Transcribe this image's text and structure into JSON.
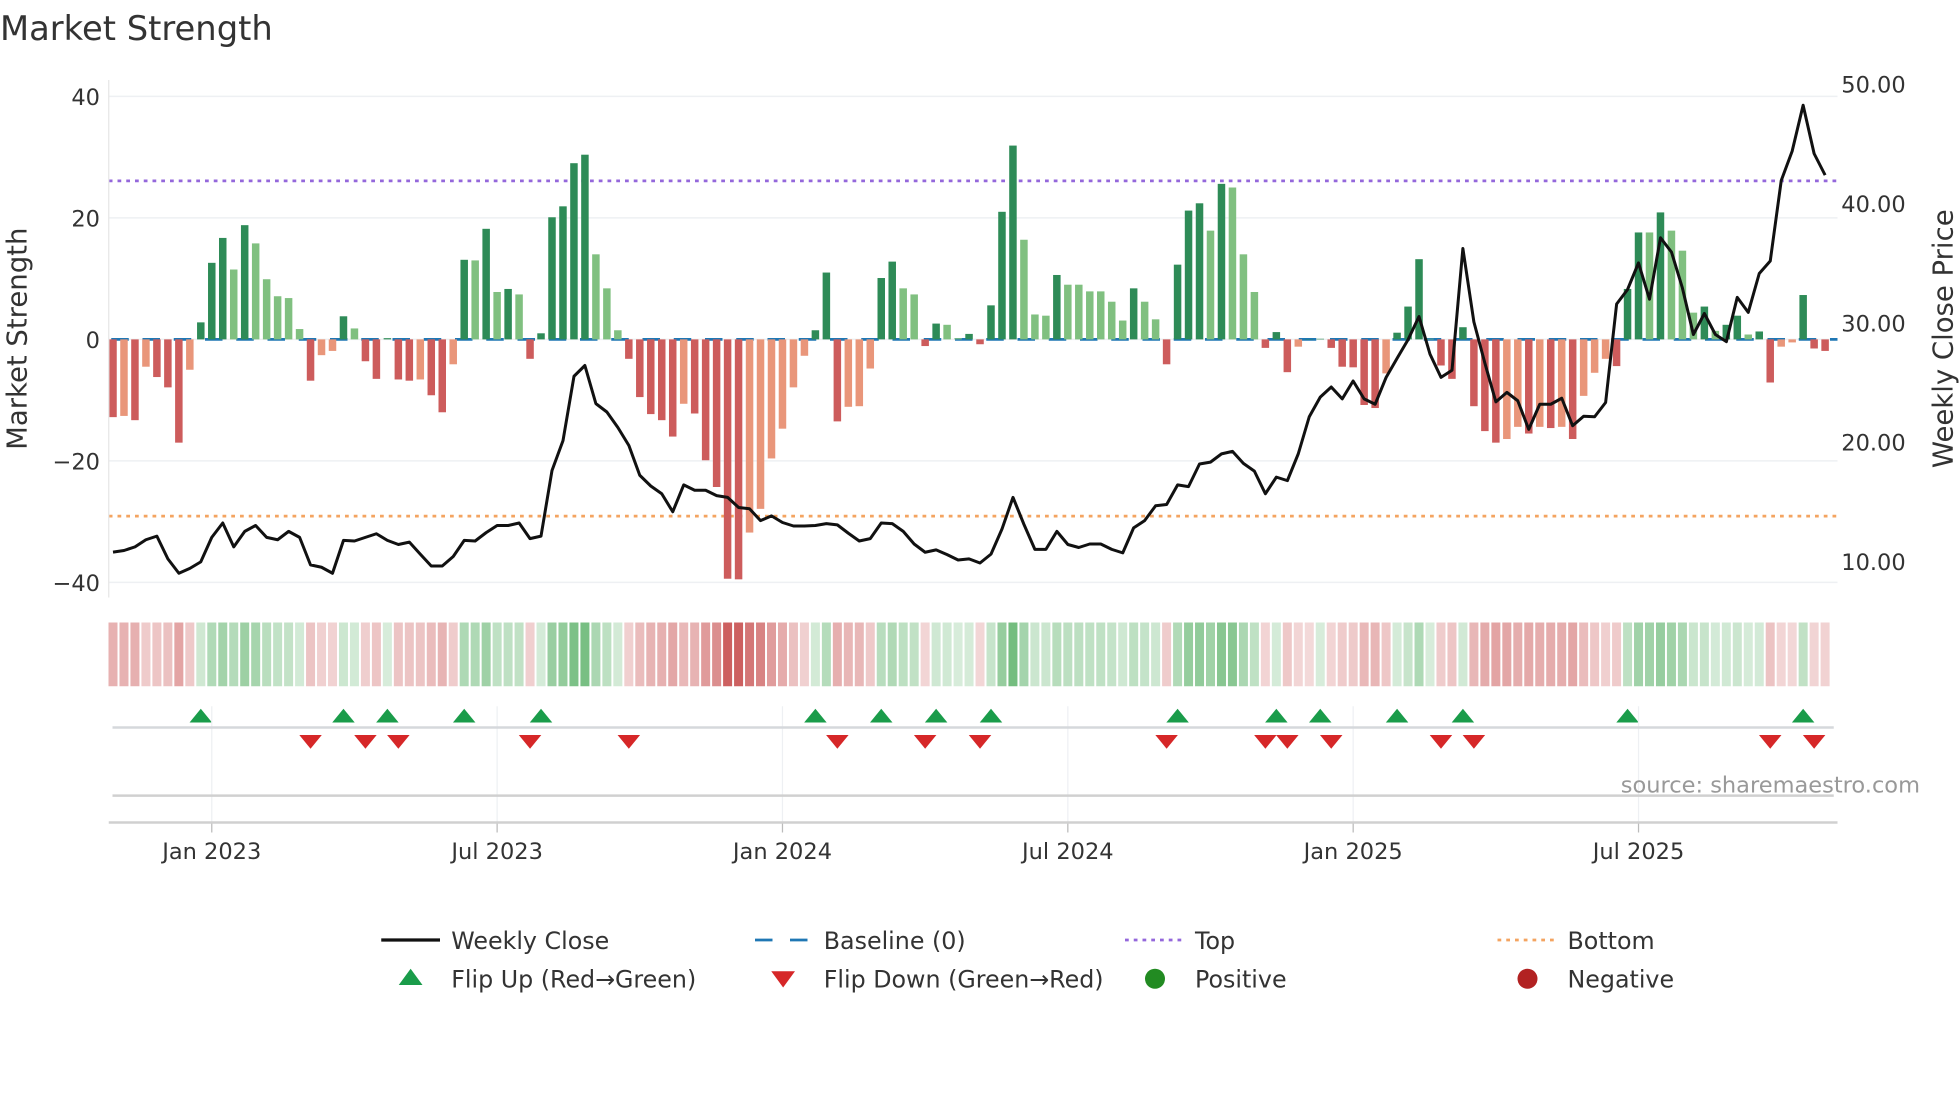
{
  "chart_data": {
    "type": "bar",
    "title": "Market Strength",
    "ylabel": "Market Strength",
    "y2label": "Weekly Close Price",
    "ylim": [
      -42,
      42
    ],
    "y2lim": [
      5,
      50
    ],
    "yticks": [
      "40",
      "20",
      "0",
      "−20",
      "−40"
    ],
    "ytick_values": [
      40,
      20,
      0,
      -20,
      -40
    ],
    "y2ticks": [
      "50.00",
      "40.00",
      "30.00",
      "20.00",
      "10.00"
    ],
    "y2tick_values": [
      50,
      40,
      30,
      20,
      10
    ],
    "x_start": "2022-10-31",
    "x_interval": "weekly",
    "xticks": [
      {
        "label": "Jan 2023",
        "date": "2023-01-02"
      },
      {
        "label": "Jul 2023",
        "date": "2023-07-03"
      },
      {
        "label": "Jan 2024",
        "date": "2024-01-01"
      },
      {
        "label": "Jul 2024",
        "date": "2024-07-01"
      },
      {
        "label": "Jan 2025",
        "date": "2024-12-30"
      },
      {
        "label": "Jul 2025",
        "date": "2025-06-30"
      }
    ],
    "top_level": 26.1,
    "bottom_level": -29.1,
    "baseline": 0,
    "grid": true,
    "legend_position": "bottom-center",
    "strength": [
      -12.8,
      -12.6,
      -13.3,
      -4.5,
      -6.2,
      -7.9,
      -17,
      -5,
      2.8,
      12.6,
      16.7,
      11.5,
      18.8,
      15.8,
      9.9,
      7.1,
      6.8,
      1.7,
      -6.8,
      -2.6,
      -1.9,
      3.8,
      1.8,
      -3.6,
      -6.5,
      0.2,
      -6.6,
      -6.8,
      -6.6,
      -9.2,
      -12,
      -4.1,
      13.1,
      13,
      18.2,
      7.8,
      8.3,
      7.4,
      -3.2,
      1,
      20.1,
      21.9,
      29,
      30.4,
      14,
      8.4,
      1.5,
      -3.2,
      -9.5,
      -12.3,
      -13.3,
      -16,
      -10.6,
      -12.2,
      -19.9,
      -24.3,
      -39.4,
      -39.5,
      -31.8,
      -27.9,
      -19.6,
      -14.7,
      -7.9,
      -2.7,
      1.5,
      11,
      -13.5,
      -11.1,
      -11,
      -4.8,
      10.1,
      12.8,
      8.4,
      7.4,
      -1.1,
      2.6,
      2.4,
      0.2,
      0.9,
      -0.8,
      5.6,
      21,
      31.9,
      16.4,
      4.1,
      3.9,
      10.6,
      9,
      9,
      7.9,
      7.9,
      6.2,
      3.1,
      8.4,
      6.2,
      3.3,
      -4.1,
      12.3,
      21.2,
      22.4,
      17.9,
      25.6,
      25,
      14,
      7.8,
      -1.4,
      1.2,
      -5.4,
      -1.2,
      0,
      0.1,
      -1.4,
      -4.5,
      -4.6,
      -10.8,
      -11.3,
      -5.6,
      1.1,
      5.4,
      13.2,
      0.1,
      -4.3,
      -6.5,
      2,
      -11,
      -15.1,
      -17,
      -16.4,
      -14.4,
      -15.5,
      -14.4,
      -14.6,
      -14.4,
      -16.4,
      -9.3,
      -5.5,
      -3.2,
      -4.4,
      8.3,
      17.6,
      17.6,
      20.9,
      17.9,
      14.6,
      4.4,
      5.4,
      1.4,
      2.4,
      3.9,
      0.8,
      1.3,
      -7.1,
      -1.2,
      -0.5,
      7.3,
      -1.5,
      -1.9
    ],
    "weekly_close": [
      10.76,
      10.9,
      11.2,
      11.8,
      12.1,
      10.2,
      9.0,
      9.4,
      9.95,
      12.0,
      13.2,
      11.2,
      12.5,
      13.0,
      12.0,
      11.8,
      12.5,
      12.0,
      9.7,
      9.5,
      9.0,
      11.75,
      11.7,
      12.0,
      12.3,
      11.75,
      11.4,
      11.6,
      10.6,
      9.6,
      9.6,
      10.4,
      11.75,
      11.7,
      12.4,
      13.0,
      13.0,
      13.2,
      11.9,
      12.1,
      17.6,
      20.1,
      25.5,
      26.4,
      23.2,
      22.5,
      21.2,
      19.7,
      17.2,
      16.3,
      15.65,
      14.15,
      16.4,
      15.95,
      15.95,
      15.5,
      15.35,
      14.5,
      14.4,
      13.4,
      13.8,
      13.25,
      12.95,
      12.95,
      13.0,
      13.15,
      13.05,
      12.35,
      11.7,
      11.9,
      13.2,
      13.15,
      12.5,
      11.45,
      10.75,
      10.95,
      10.55,
      10.1,
      10.2,
      9.85,
      10.6,
      12.7,
      15.35,
      13.1,
      11.0,
      11.0,
      12.5,
      11.4,
      11.15,
      11.45,
      11.45,
      11.0,
      10.7,
      12.8,
      13.4,
      14.65,
      14.75,
      16.4,
      16.25,
      18.15,
      18.3,
      19.0,
      19.2,
      18.2,
      17.55,
      15.65,
      17.05,
      16.75,
      19.0,
      22.1,
      23.75,
      24.6,
      23.6,
      25.1,
      23.6,
      23.15,
      25.4,
      27.0,
      28.55,
      30.5,
      27.35,
      25.4,
      26.0,
      36.2,
      30.05,
      26.6,
      23.35,
      24.15,
      23.45,
      21.05,
      23.15,
      23.15,
      23.65,
      21.35,
      22.15,
      22.1,
      23.3,
      31.55,
      32.75,
      35.0,
      31.95,
      37.1,
      35.9,
      32.9,
      29.0,
      30.75,
      29.0,
      28.4,
      32.1,
      30.85,
      34.1,
      35.15,
      41.9,
      44.35,
      48.2,
      44.15,
      42.35
    ],
    "legend": [
      {
        "label": "Weekly Close",
        "symbol": "line"
      },
      {
        "label": "Baseline (0)",
        "symbol": "dashed"
      },
      {
        "label": "Top",
        "symbol": "dotted"
      },
      {
        "label": "Bottom",
        "symbol": "dotted"
      },
      {
        "label": "Flip Up (Red→Green)",
        "symbol": "triangle-up"
      },
      {
        "label": "Flip Down (Green→Red)",
        "symbol": "triangle-down"
      },
      {
        "label": "Positive",
        "symbol": "circle"
      },
      {
        "label": "Negative",
        "symbol": "circle"
      }
    ],
    "source": "source: sharemaestro.com"
  },
  "colors": {
    "pos_strong": "#2e8b57",
    "pos_weak": "#80c080",
    "neg_strong": "#cd5c5c",
    "neg_weak": "#e9967a",
    "baseline": "#1f77b4",
    "top": "#9467db",
    "bottom": "#f4a460",
    "flip_up": "#1a9c4a",
    "flip_down": "#d62728",
    "positive": "#228b22",
    "negative": "#b22222",
    "close": "#111111"
  }
}
